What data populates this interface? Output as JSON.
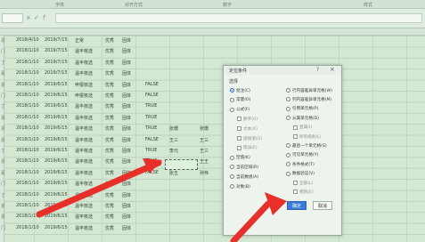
{
  "ribbon": {
    "labels": [
      "字体",
      "对齐方式",
      "数字",
      "样式"
    ]
  },
  "formula_bar": {
    "icons": [
      "cancel-icon",
      "enter-icon",
      "function-icon"
    ]
  },
  "sheet": {
    "col_a": [
      "素",
      "门",
      "丁",
      "素",
      "素",
      "门",
      "丁",
      "素",
      "素",
      "素",
      "丁",
      "素",
      "素",
      "门",
      "丁",
      "素",
      "素",
      "门"
    ],
    "col_b": [
      "2018/4/10",
      "2018/1/10",
      "2018/1/10",
      "2018/1/10",
      "2018/1/10",
      "2018/1/10",
      "2018/1/10",
      "2018/1/10",
      "2018/1/10",
      "2018/1/10",
      "2018/1/10",
      "2018/1/10",
      "2018/1/10",
      "2018/1/10",
      "2018/1/10",
      "2018/1/10",
      "2018/1/10",
      "2018/1/10"
    ],
    "col_c": [
      "2019/7/15",
      "2019/7/15",
      "2019/7/15",
      "2019/7/15",
      "2019/6/15",
      "2019/6/15",
      "2019/6/15",
      "2019/6/15",
      "2019/6/15",
      "2019/6/15",
      "2019/6/15",
      "2019/6/15",
      "2019/6/15",
      "2019/6/15",
      "2019/6/15",
      "2019/6/15",
      "2019/6/15",
      "2019/6/15"
    ],
    "col_d": [
      "正常",
      "温丰核选",
      "温丰核选",
      "温丰核选",
      "申报核选",
      "申报核选",
      "温丰核选",
      "温丰核选",
      "温丰核选",
      "温丰核选",
      "温丰核选",
      "温丰核选",
      "温丰核选",
      "温丰核选",
      "温丰核选",
      "温丰核选",
      "温丰核选",
      "温丰核选"
    ],
    "col_e": [
      "优秀",
      "优秀",
      "优秀",
      "优秀",
      "优秀",
      "优秀",
      "优秀",
      "优秀",
      "优秀",
      "优秀",
      "优秀",
      "优秀",
      "优秀",
      "优秀",
      "优秀",
      "优秀",
      "优秀",
      "优秀"
    ],
    "col_f": [
      "固体",
      "固体",
      "固体",
      "固体",
      "固体",
      "固体",
      "固体",
      "固体",
      "固体",
      "固体",
      "固体",
      "固体",
      "固体",
      "固体",
      "固体",
      "固体",
      "固体",
      "固体"
    ],
    "col_g": [
      "FALSE",
      "FALSE",
      "TRUE",
      "TRUE",
      "TRUE",
      "FALSE",
      "TRUE",
      "TRUE",
      "FALSE"
    ],
    "names_h": [
      "张珊",
      "王三",
      "李元",
      "王王",
      "张五"
    ],
    "names_i": [
      "张珊",
      "王三",
      "王三",
      "王王",
      "孙伟"
    ]
  },
  "dialog": {
    "title": "定位条件",
    "help": "?",
    "close": "×",
    "group": "选择",
    "left_options": [
      {
        "label": "批注(C)",
        "checked": true
      },
      {
        "label": "常量(O)"
      },
      {
        "label": "公式(F)"
      },
      {
        "label": "数字(U)",
        "sub": true
      },
      {
        "label": "文本(X)",
        "sub": true
      },
      {
        "label": "逻辑值(G)",
        "sub": true
      },
      {
        "label": "错误(E)",
        "sub": true
      },
      {
        "label": "空值(K)"
      },
      {
        "label": "当前区域(R)"
      },
      {
        "label": "当前数组(A)"
      },
      {
        "label": "对象(B)"
      }
    ],
    "right_options": [
      {
        "label": "行内容差异单元格(W)"
      },
      {
        "label": "列内容差异单元格(M)"
      },
      {
        "label": "引用单元格(P)"
      },
      {
        "label": "从属单元格(D)"
      },
      {
        "label": "直属(I)",
        "sub": true
      },
      {
        "label": "所有级别(L)",
        "sub": true
      },
      {
        "label": "最后一个单元格(S)"
      },
      {
        "label": "可见单元格(Y)"
      },
      {
        "label": "条件格式(T)"
      },
      {
        "label": "数据验证(V)"
      },
      {
        "label": "全部(L)",
        "sub": true
      },
      {
        "label": "相同(E)",
        "sub": true
      }
    ],
    "ok": "确定",
    "cancel": "取消",
    "colors": {
      "accent": "#3b7bd8",
      "arrow": "#e8302b"
    }
  }
}
